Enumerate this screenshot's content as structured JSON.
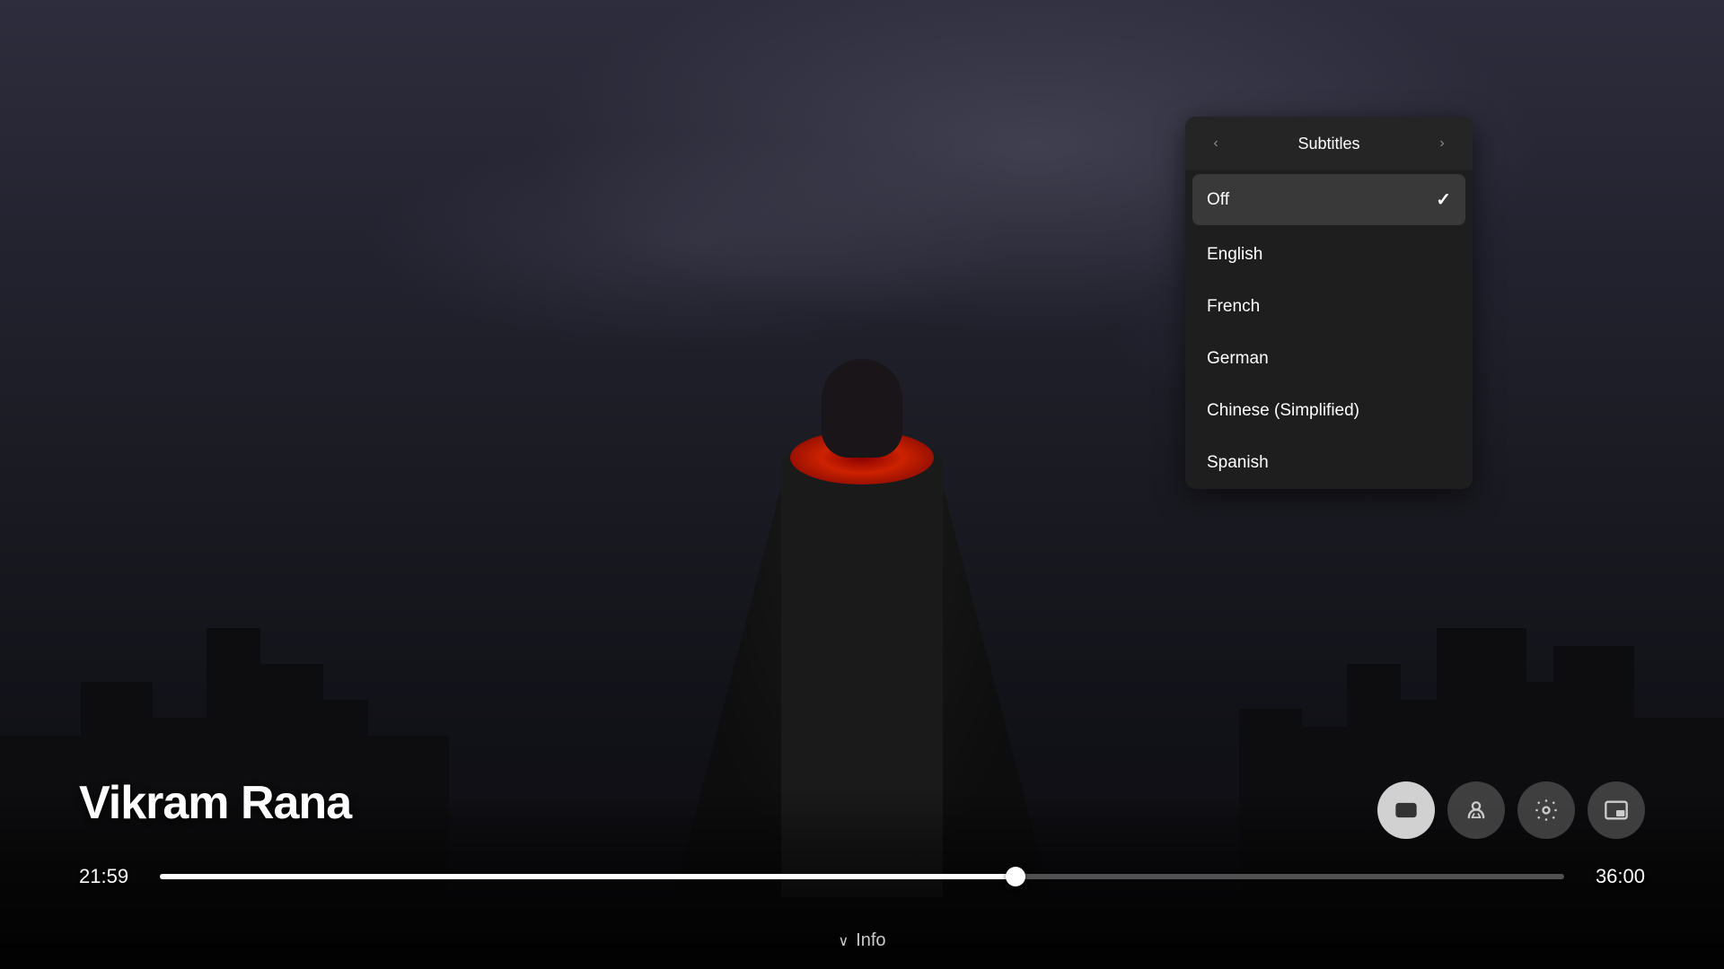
{
  "background": {
    "alt": "Vikram Rana movie background - superhero figure overlooking city"
  },
  "subtitles_panel": {
    "title": "Subtitles",
    "nav_left_label": "‹",
    "nav_right_label": "›",
    "options": [
      {
        "id": "off",
        "label": "Off",
        "selected": true
      },
      {
        "id": "english",
        "label": "English",
        "selected": false
      },
      {
        "id": "french",
        "label": "French",
        "selected": false
      },
      {
        "id": "german",
        "label": "German",
        "selected": false
      },
      {
        "id": "chinese",
        "label": "Chinese (Simplified)",
        "selected": false
      },
      {
        "id": "spanish",
        "label": "Spanish",
        "selected": false
      }
    ]
  },
  "player": {
    "movie_title": "Vikram Rana",
    "current_time": "21:59",
    "total_time": "36:00",
    "progress_percent": 61,
    "info_label": "Info",
    "controls": {
      "subtitles_label": "CC",
      "audio_label": "♪",
      "settings_label": "⚙",
      "pip_label": "⧉"
    }
  }
}
